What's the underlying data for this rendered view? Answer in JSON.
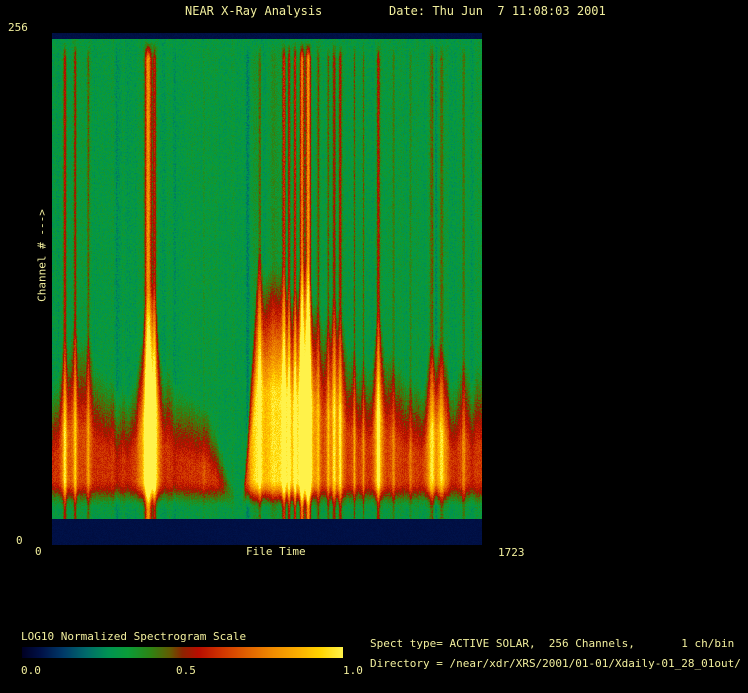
{
  "header": {
    "title": "NEAR X-Ray Analysis",
    "date": "Date: Thu Jun  7 11:08:03 2001"
  },
  "plot": {
    "y_axis_title": "Channel # --->",
    "y_max_label": "256",
    "y_min_label": "0",
    "x_axis_title": "File Time",
    "x_min_label": "0",
    "x_max_label": "1723"
  },
  "colorbar": {
    "label": "LOG10 Normalized Spectrogram Scale",
    "ticks": [
      "0.0",
      "0.5",
      "1.0"
    ]
  },
  "info": {
    "line1": "Spect type= ACTIVE SOLAR,  256 Channels,       1 ch/bin",
    "line2": "Directory = /near/xdr/XRS/2001/01-01/Xdaily-01_28_01out/"
  },
  "colors": {
    "background": "#000000",
    "text": "#f2ef9d",
    "edge_band": "#0b1448"
  },
  "chart_data": {
    "type": "heatmap",
    "title": "NEAR X-Ray Analysis",
    "xlabel": "File Time",
    "ylabel": "Channel # --->",
    "xlim": [
      0,
      1723
    ],
    "ylim": [
      0,
      256
    ],
    "legend_position": "bottom-left colorbar",
    "grid": false,
    "colorbar": {
      "label": "LOG10 Normalized Spectrogram Scale",
      "tick_values": [
        0.0,
        0.5,
        1.0
      ],
      "stops": [
        [
          0.0,
          "#000022"
        ],
        [
          0.06,
          "#001148"
        ],
        [
          0.13,
          "#003a68"
        ],
        [
          0.2,
          "#006a6a"
        ],
        [
          0.27,
          "#009352"
        ],
        [
          0.33,
          "#0a9c38"
        ],
        [
          0.4,
          "#2d8414"
        ],
        [
          0.46,
          "#615c02"
        ],
        [
          0.5,
          "#8c2300"
        ],
        [
          0.55,
          "#b80d00"
        ],
        [
          0.62,
          "#cf3300"
        ],
        [
          0.7,
          "#e06000"
        ],
        [
          0.78,
          "#ef8a00"
        ],
        [
          0.86,
          "#fbae00"
        ],
        [
          0.93,
          "#ffd400"
        ],
        [
          1.0,
          "#fff24a"
        ]
      ]
    },
    "background_value": 0.31,
    "noise_amplitude": 0.085,
    "edge_band_value": 0.055,
    "edge_bands_channels": {
      "bottom": 13,
      "top": 3
    },
    "streaks": [
      {
        "t": 52,
        "a": 0.5,
        "w": 5
      },
      {
        "t": 93,
        "a": 0.38,
        "w": 4
      },
      {
        "t": 145,
        "a": 0.3,
        "w": 4
      },
      {
        "t": 262,
        "a": -0.1,
        "w": 6,
        "f": 0
      },
      {
        "t": 386,
        "a": 1.0,
        "w": 9,
        "f": 1.2
      },
      {
        "t": 411,
        "a": 0.5,
        "w": 5
      },
      {
        "t": 491,
        "a": -0.08,
        "w": 4,
        "f": 0
      },
      {
        "t": 608,
        "a": 0.12,
        "w": 4
      },
      {
        "t": 785,
        "a": -0.18,
        "w": 5,
        "f": 0
      },
      {
        "t": 813,
        "a": 0.12,
        "w": 10,
        "f": 0.9
      },
      {
        "t": 833,
        "a": 0.3,
        "w": 4
      },
      {
        "t": 890,
        "a": 0.15,
        "w": 12,
        "f": 1.0
      },
      {
        "t": 930,
        "a": 0.6,
        "w": 5
      },
      {
        "t": 950,
        "a": 0.5,
        "w": 4
      },
      {
        "t": 974,
        "a": 0.55,
        "w": 4
      },
      {
        "t": 1002,
        "a": 0.9,
        "w": 6,
        "f": 1.0
      },
      {
        "t": 1027,
        "a": 1.0,
        "w": 7,
        "f": 1.2
      },
      {
        "t": 1067,
        "a": 0.3,
        "w": 4
      },
      {
        "t": 1107,
        "a": 0.35,
        "w": 4
      },
      {
        "t": 1131,
        "a": 0.4,
        "w": 5
      },
      {
        "t": 1155,
        "a": 0.5,
        "w": 5
      },
      {
        "t": 1212,
        "a": 0.3,
        "w": 3
      },
      {
        "t": 1248,
        "a": 0.25,
        "w": 3
      },
      {
        "t": 1308,
        "a": 0.5,
        "w": 5,
        "f": 0.9
      },
      {
        "t": 1369,
        "a": 0.25,
        "w": 4
      },
      {
        "t": 1437,
        "a": 0.2,
        "w": 4
      },
      {
        "t": 1522,
        "a": 0.3,
        "w": 6,
        "f": 0.8
      },
      {
        "t": 1538,
        "a": -0.12,
        "w": 4,
        "f": 0
      },
      {
        "t": 1562,
        "a": 0.3,
        "w": 6,
        "f": 0.8
      },
      {
        "t": 1650,
        "a": 0.25,
        "w": 4
      }
    ],
    "band": {
      "top_channels": [
        80,
        95,
        100,
        85,
        78,
        82,
        95,
        85,
        75,
        68,
        45,
        8,
        115,
        110,
        95,
        100,
        110,
        100,
        85,
        95,
        90,
        80,
        78,
        80,
        88,
        85
      ],
      "base_strength": 0.3,
      "streak_boost": 0.28,
      "flame_rise": 28,
      "bottom_fade": [
        17,
        33
      ]
    }
  }
}
